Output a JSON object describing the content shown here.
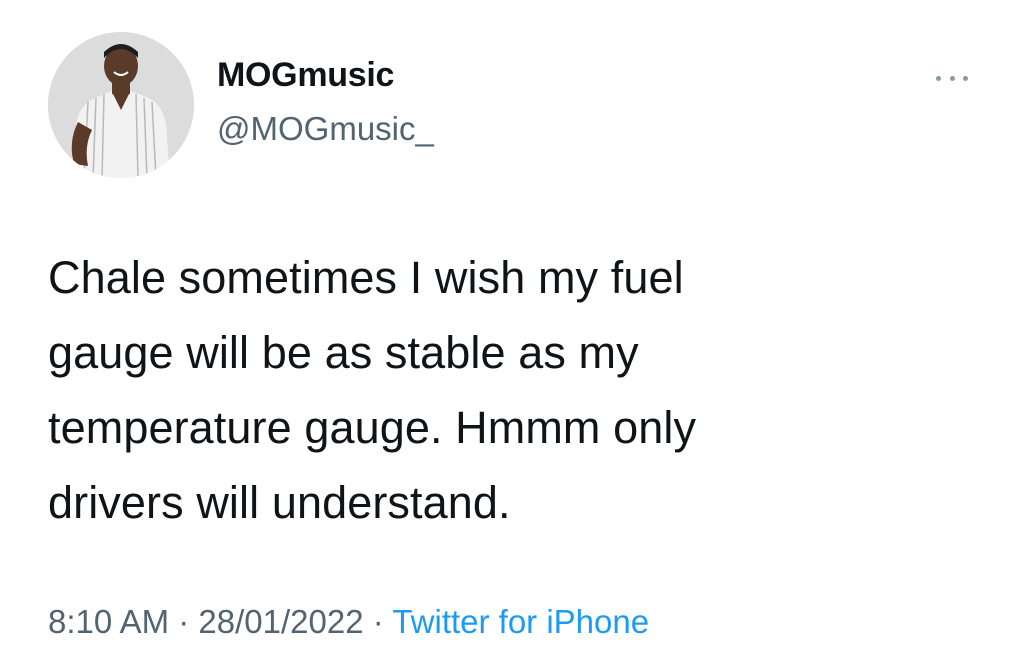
{
  "author": {
    "display_name": "MOGmusic",
    "handle": "@MOGmusic_"
  },
  "icons": {
    "more": "more-horizontal-icon"
  },
  "tweet": {
    "text_lines": [
      "Chale sometimes I wish my fuel",
      "gauge will be as stable as my",
      "temperature gauge. Hmmm only",
      "drivers will understand."
    ]
  },
  "meta": {
    "time": "8:10 AM",
    "separator": " · ",
    "date": "28/01/2022",
    "source": "Twitter for iPhone"
  },
  "colors": {
    "text": "#0f1419",
    "secondary": "#536471",
    "link": "#1d9bf0"
  }
}
